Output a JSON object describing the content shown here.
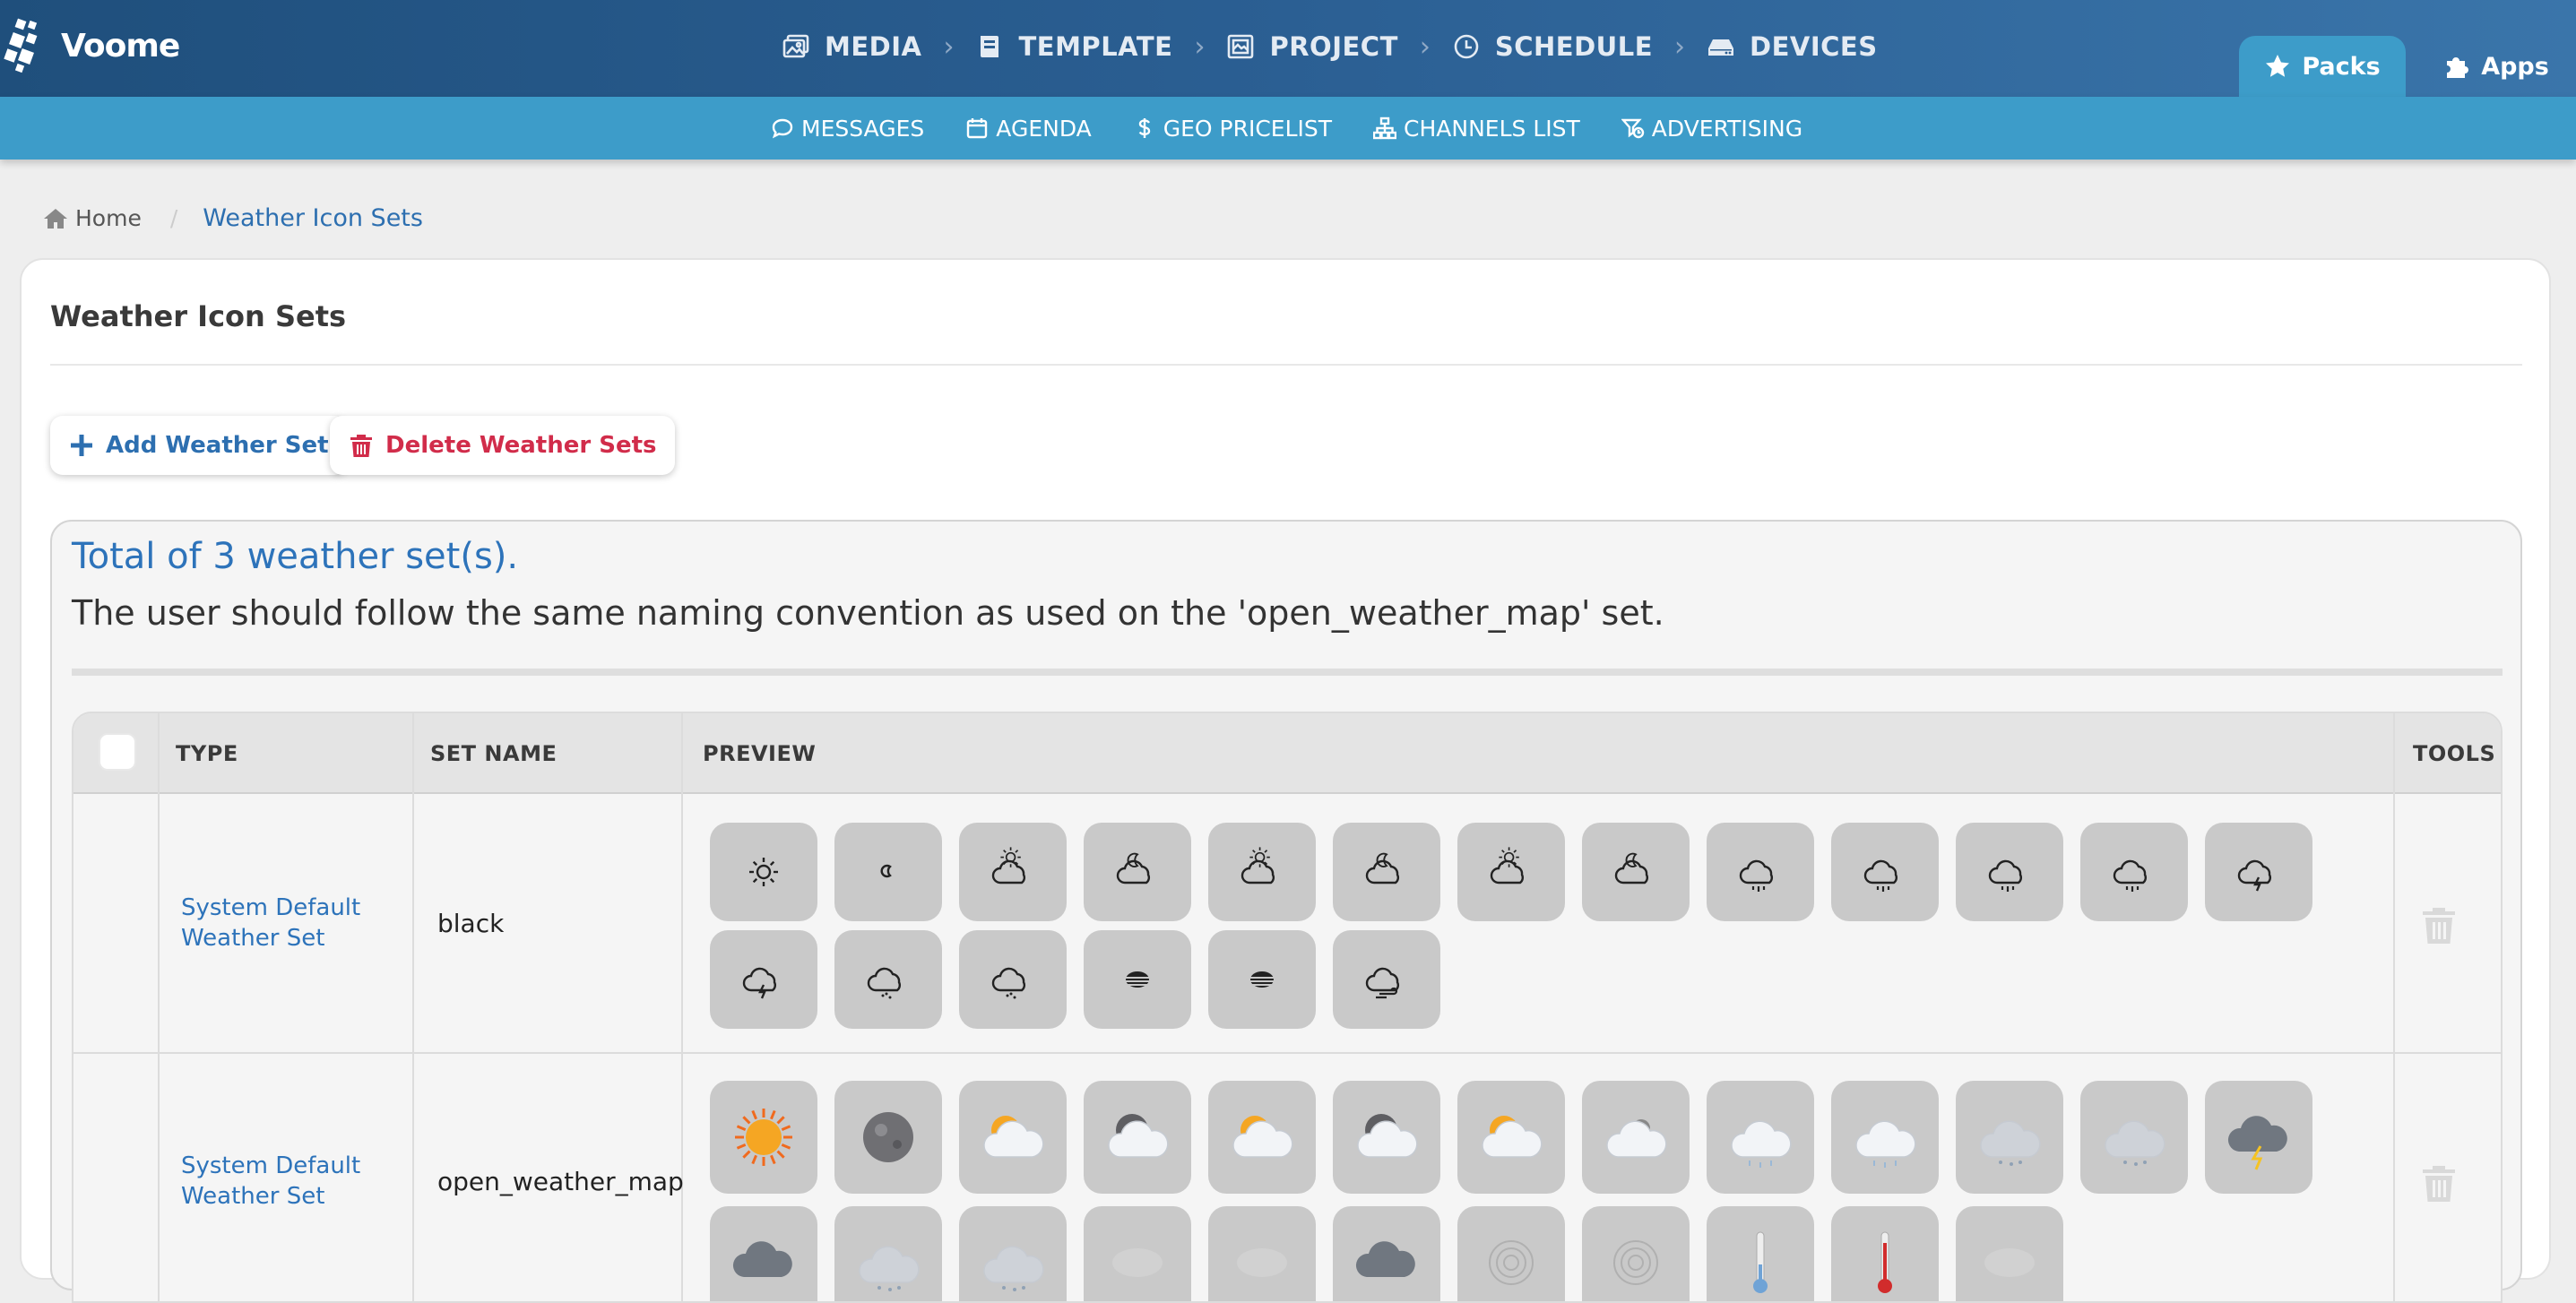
{
  "app": {
    "logo_text": "Voome"
  },
  "main_nav": [
    {
      "label": "MEDIA",
      "icon": "images-icon"
    },
    {
      "label": "TEMPLATE",
      "icon": "book-icon"
    },
    {
      "label": "PROJECT",
      "icon": "project-icon"
    },
    {
      "label": "SCHEDULE",
      "icon": "clock-icon"
    },
    {
      "label": "DEVICES",
      "icon": "hdd-icon"
    }
  ],
  "tabs": {
    "packs": "Packs",
    "apps": "Apps"
  },
  "sub_nav": [
    {
      "label": "MESSAGES",
      "icon": "comment-icon"
    },
    {
      "label": "AGENDA",
      "icon": "calendar-icon"
    },
    {
      "label": "GEO PRICELIST",
      "icon": "dollar-icon"
    },
    {
      "label": "CHANNELS LIST",
      "icon": "sitemap-icon"
    },
    {
      "label": "ADVERTISING",
      "icon": "ad-icon"
    }
  ],
  "breadcrumb": {
    "home": "Home",
    "current": "Weather Icon Sets"
  },
  "page": {
    "title": "Weather Icon Sets",
    "add_button": "Add Weather Set",
    "delete_button": "Delete Weather Sets",
    "summary": "Total of 3 weather set(s).",
    "description": "The user should follow the same naming convention as used on the 'open_weather_map' set."
  },
  "table": {
    "headers": {
      "type": "TYPE",
      "set_name": "SET NAME",
      "preview": "PREVIEW",
      "tools": "TOOLS"
    },
    "rows": [
      {
        "type_line1": "System Default",
        "type_line2": "Weather Set",
        "set_name": "black",
        "preview": [
          "clear-day",
          "clear-night",
          "few-clouds-day",
          "few-clouds-night",
          "scattered-clouds-day",
          "scattered-clouds-night",
          "broken-clouds-day",
          "broken-clouds-night",
          "shower-rain-day",
          "shower-rain-night",
          "rain-day",
          "rain-night",
          "thunderstorm-day",
          "thunderstorm-night",
          "snow-day",
          "snow-night",
          "mist-day",
          "mist-night",
          "wind"
        ]
      },
      {
        "type_line1": "System Default",
        "type_line2": "Weather Set",
        "set_name": "open_weather_map",
        "preview": [
          "sun",
          "moon",
          "sun-cloud",
          "moon-cloud",
          "sun-cloud-2",
          "moon-cloud-2",
          "cloud-sun",
          "cloud-night",
          "rain-cloud",
          "rain-cloud-2",
          "snow-cloud",
          "snow-cloud-2",
          "thunder-cloud",
          "dark-cloud",
          "snow-rain",
          "snow-rain-2",
          "fog",
          "fog-2",
          "storm-cloud",
          "spiral",
          "spiral-2",
          "thermometer-cold",
          "thermometer-hot",
          "haze"
        ]
      }
    ]
  },
  "colors": {
    "accent": "#2d73ba",
    "danger": "#d12c4a",
    "subbar": "#3d9cc9",
    "topbar": "#2b5f93"
  }
}
